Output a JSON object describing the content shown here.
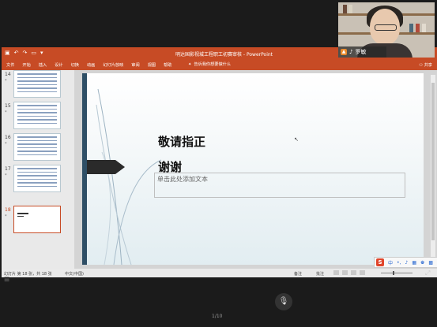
{
  "app": {
    "name": "PowerPoint",
    "window_title": "明达国影视城工程职工初赛审核 - PowerPoint",
    "accent_color": "#c74b25"
  },
  "ribbon": {
    "tabs": [
      "文件",
      "开始",
      "插入",
      "设计",
      "切换",
      "动画",
      "幻灯片放映",
      "审阅",
      "视图",
      "帮助"
    ],
    "tell_me": "告诉我你想要做什么",
    "share": "共享"
  },
  "thumbnails": [
    {
      "num": "14",
      "star": "*"
    },
    {
      "num": "15",
      "star": "*"
    },
    {
      "num": "16",
      "star": "*"
    },
    {
      "num": "17",
      "star": "*"
    },
    {
      "num": "18",
      "star": "*",
      "active": true
    }
  ],
  "slide": {
    "heading": "敬请指正",
    "thanks": "谢谢",
    "placeholder": "单击此处添加文本"
  },
  "statusbar": {
    "slide_info": "幻灯片 第 18 张，共 18 张",
    "language": "中文(中国)",
    "notes": "备注",
    "comments": "批注"
  },
  "webcam": {
    "name": "罗敏"
  },
  "meeting": {
    "pager": "1/10"
  }
}
